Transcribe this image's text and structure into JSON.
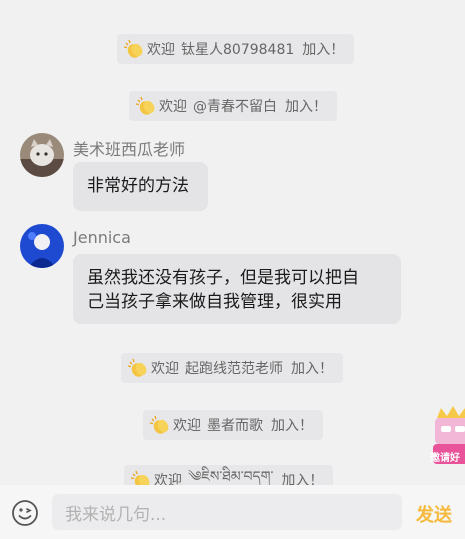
{
  "system_messages": [
    {
      "welcome": "欢迎",
      "name": "钛星人80798481",
      "action": "加入！"
    },
    {
      "welcome": "欢迎",
      "name": "@青春不留白",
      "action": "加入！"
    },
    {
      "welcome": "欢迎",
      "name": "起跑线范范老师",
      "action": "加入！"
    },
    {
      "welcome": "欢迎",
      "name": "墨者而歌",
      "action": "加入！"
    },
    {
      "welcome": "欢迎",
      "name": "༄ཇིས་ཐིམ་བདག་",
      "action": "加入！"
    }
  ],
  "messages": [
    {
      "user": "美术班西瓜老师",
      "text": "非常好的方法"
    },
    {
      "user": "Jennica",
      "text_line1": "虽然我还没有孩子，但是我可以把自",
      "text_line2": "己当孩子拿来做自我管理，很实用"
    }
  ],
  "badge": {
    "label": "邀请好"
  },
  "input": {
    "placeholder": "我来说几句..."
  },
  "send": {
    "label": "发送"
  },
  "colors": {
    "accent": "#f5b93c",
    "background": "#f1f1f2"
  }
}
